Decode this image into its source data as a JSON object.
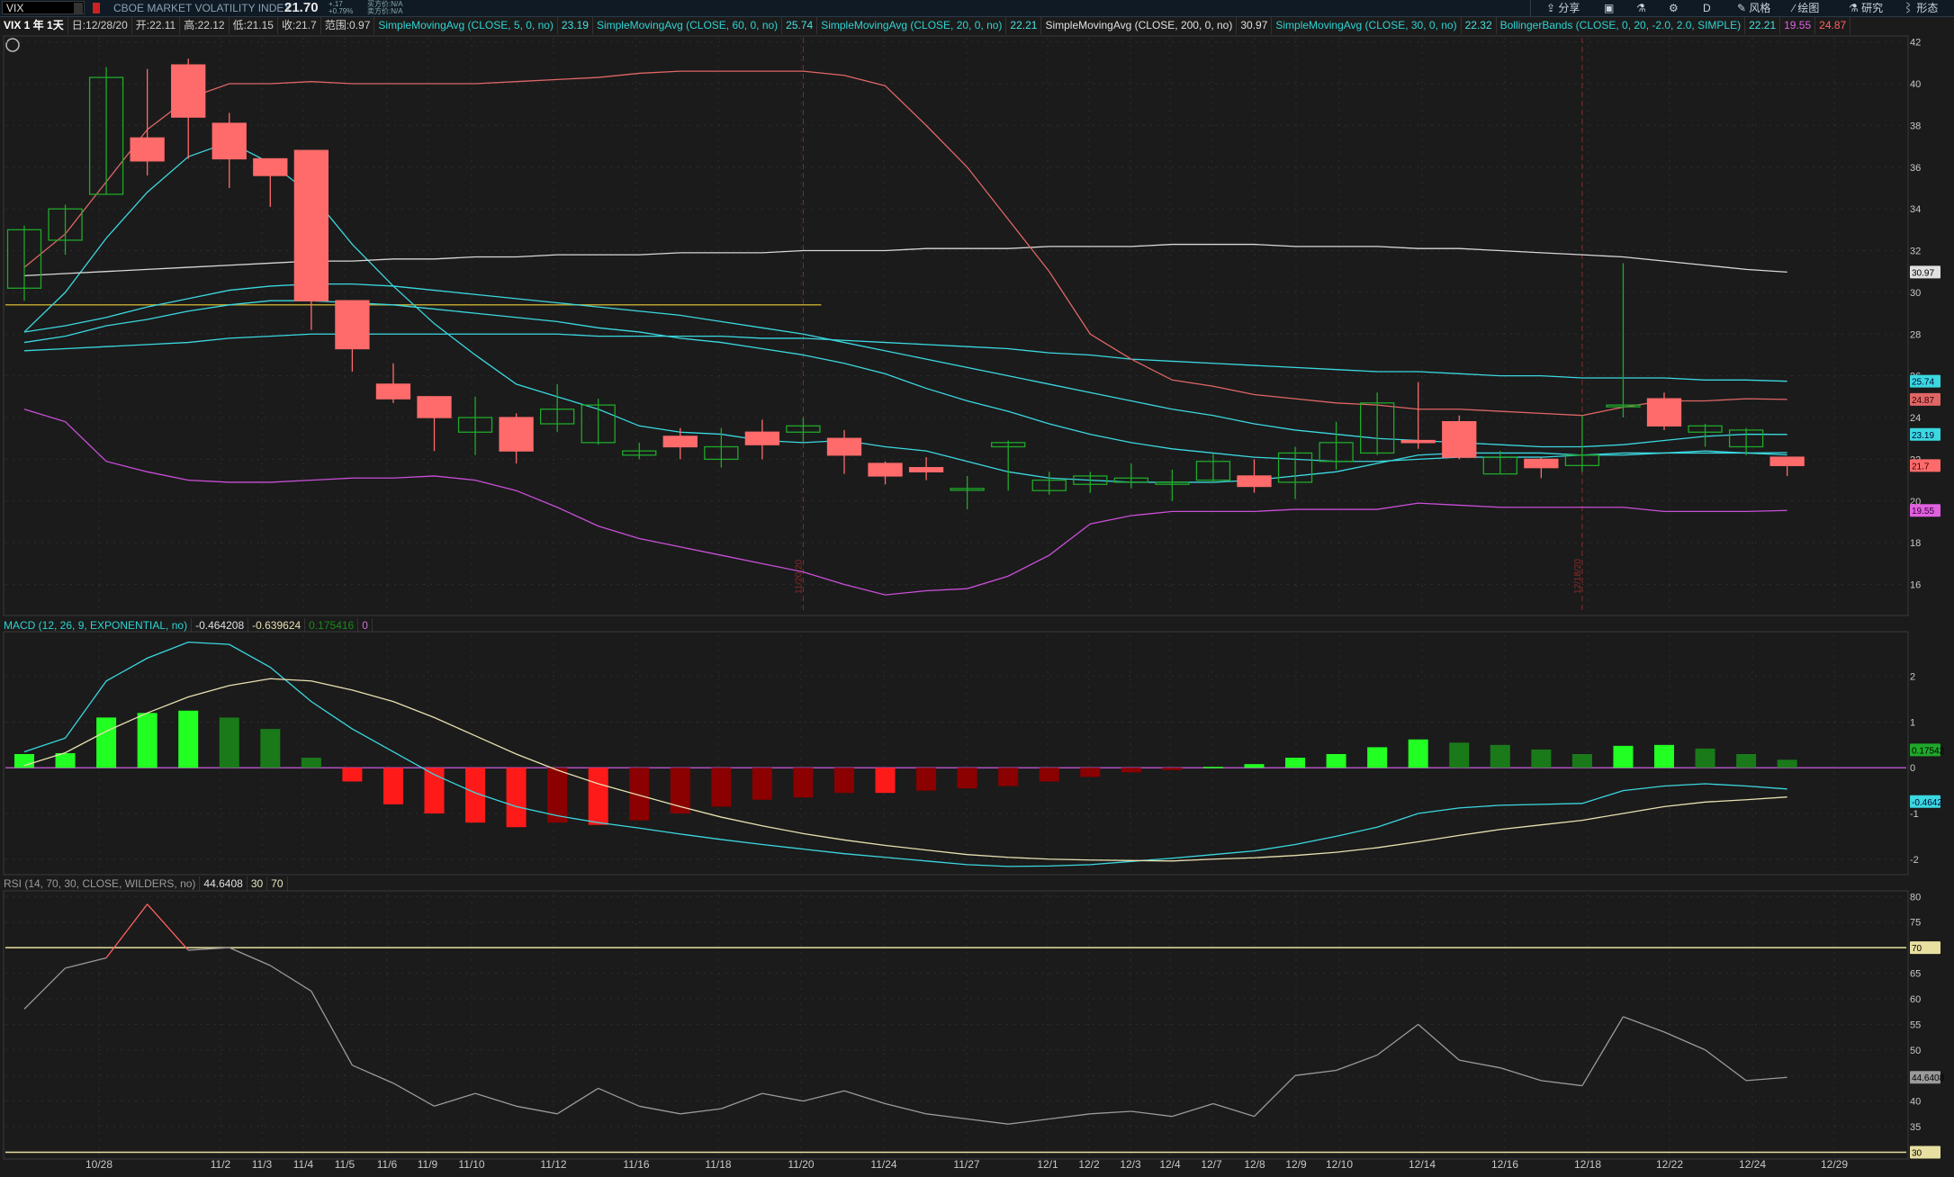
{
  "header": {
    "symbol": "VIX",
    "description": "CBOE MARKET VOLATILITY INDEX",
    "last_price": "21.70",
    "net_change": "+.17",
    "pct_change": "+0.79%",
    "bid_label": "买方价:N/A",
    "ask_label": "卖方价:N/A",
    "toolbar": {
      "share": "分享",
      "timeframe": "D",
      "style": "风格",
      "drawing": "绘图",
      "studies": "研究",
      "patterns": "形态"
    }
  },
  "infobar": {
    "chart_label": "VIX 1 年 1天",
    "date": "日:12/28/20",
    "open": "开:22.11",
    "high": "高:22.12",
    "low": "低:21.15",
    "close": "收:21.7",
    "range": "范围:0.97",
    "studies": [
      {
        "name": "SimpleMovingAvg (CLOSE, 5, 0, no)",
        "value": "23.19"
      },
      {
        "name": "SimpleMovingAvg (CLOSE, 60, 0, no)",
        "value": "25.74"
      },
      {
        "name": "SimpleMovingAvg (CLOSE, 20, 0, no)",
        "value": "22.21"
      },
      {
        "name": "SimpleMovingAvg (CLOSE, 200, 0, no)",
        "value": "30.97"
      },
      {
        "name": "SimpleMovingAvg (CLOSE, 30, 0, no)",
        "value": "22.32"
      },
      {
        "name": "BollingerBands (CLOSE, 0, 20, -2.0, 2.0, SIMPLE)",
        "value": "22.21",
        "lower": "19.55",
        "upper": "24.87"
      }
    ]
  },
  "macd_header": {
    "name": "MACD (12, 26, 9, EXPONENTIAL, no)",
    "value": "-0.464208",
    "avg": "-0.639624",
    "diff": "0.175416",
    "zero": "0"
  },
  "rsi_header": {
    "name": "RSI (14, 70, 30, CLOSE, WILDERS, no)",
    "value": "44.6408",
    "low": "30",
    "high": "70"
  },
  "markers": [
    "11/20/20",
    "12/18/20"
  ],
  "price_tags": [
    "30.97",
    "25.74",
    "24.87",
    "23.19",
    "21.7",
    "19.55"
  ],
  "macd_tags": [
    "0.17542",
    "-0.4642"
  ],
  "rsi_tags": [
    "70",
    "44.6408",
    "30"
  ],
  "colors": {
    "up": "#1fa82a",
    "down": "#ff6b6b",
    "sma5": "#3bd8e0",
    "sma20": "#3bd8e0",
    "sma30": "#3bd8e0",
    "sma60": "#3bd8e0",
    "sma200": "#d8d8d8",
    "bb_upper": "#e06666",
    "bb_lower": "#c94fd8",
    "macd": "#3bd8e0",
    "macd_avg": "#e8e0b0",
    "hist_up_bright": "#22ff22",
    "hist_up_dark": "#1a7a1a",
    "hist_down_bright": "#ff1a1a",
    "hist_down_dark": "#8b0000",
    "rsi_line": "#9a9a9a",
    "rsi_hot": "#ff6060"
  },
  "chart_data": [
    {
      "type": "candlestick",
      "title": "VIX 1 年 1天",
      "x_tick_labels": [
        "10/28",
        "11/2",
        "11/3",
        "11/4",
        "11/5",
        "11/6",
        "11/9",
        "11/10",
        "11/12",
        "11/16",
        "11/18",
        "11/20",
        "11/24",
        "11/27",
        "12/1",
        "12/2",
        "12/3",
        "12/4",
        "12/7",
        "12/8",
        "12/9",
        "12/10",
        "12/14",
        "12/16",
        "12/18",
        "12/22",
        "12/24",
        "12/29"
      ],
      "y_ticks": [
        16,
        18,
        20,
        22,
        24,
        26,
        28,
        30,
        32,
        34,
        36,
        38,
        40,
        42
      ],
      "ylim": [
        14.6,
        42.2
      ],
      "dates": [
        "10/26",
        "10/27",
        "10/28",
        "10/29",
        "10/30",
        "11/2",
        "11/3",
        "11/4",
        "11/5",
        "11/6",
        "11/9",
        "11/10",
        "11/11",
        "11/12",
        "11/13",
        "11/16",
        "11/17",
        "11/18",
        "11/19",
        "11/20",
        "11/23",
        "11/24",
        "11/25",
        "11/27",
        "11/30",
        "12/1",
        "12/2",
        "12/3",
        "12/4",
        "12/7",
        "12/8",
        "12/9",
        "12/10",
        "12/11",
        "12/14",
        "12/15",
        "12/16",
        "12/17",
        "12/18",
        "12/21",
        "12/22",
        "12/23",
        "12/24",
        "12/28"
      ],
      "open": [
        30.2,
        32.5,
        34.7,
        37.4,
        40.9,
        38.1,
        36.4,
        36.8,
        29.6,
        25.6,
        25.0,
        23.3,
        24.0,
        23.7,
        22.8,
        22.2,
        23.1,
        22.0,
        23.3,
        23.3,
        23.0,
        21.8,
        21.6,
        20.6,
        22.6,
        20.5,
        20.8,
        20.9,
        20.8,
        21.0,
        21.2,
        20.9,
        21.9,
        22.3,
        22.9,
        23.8,
        21.3,
        22.0,
        21.7,
        24.6,
        24.9,
        23.3,
        22.6,
        22.1
      ],
      "close": [
        33.0,
        34.0,
        40.3,
        36.3,
        38.4,
        36.4,
        35.6,
        29.6,
        27.3,
        24.9,
        24.0,
        24.0,
        22.4,
        24.4,
        24.6,
        22.4,
        22.6,
        22.6,
        22.7,
        23.6,
        22.2,
        21.2,
        21.4,
        20.6,
        22.8,
        21.0,
        21.2,
        21.1,
        20.9,
        21.9,
        20.7,
        22.3,
        22.8,
        24.7,
        22.8,
        22.1,
        22.1,
        21.6,
        22.2,
        24.6,
        23.6,
        23.6,
        23.4,
        21.7
      ],
      "high": [
        33.2,
        34.2,
        40.8,
        40.7,
        41.2,
        38.6,
        36.4,
        36.8,
        28.3,
        26.6,
        24.8,
        25.0,
        24.2,
        25.6,
        24.9,
        22.8,
        23.5,
        23.5,
        23.9,
        24.0,
        23.4,
        21.9,
        22.1,
        21.2,
        22.9,
        21.4,
        21.4,
        21.8,
        21.5,
        22.3,
        22.0,
        22.6,
        23.8,
        25.2,
        25.7,
        24.1,
        22.4,
        22.1,
        24.1,
        31.4,
        25.2,
        23.7,
        23.5,
        22.1
      ],
      "low": [
        29.6,
        31.8,
        34.7,
        35.6,
        36.4,
        35.0,
        34.1,
        28.2,
        26.2,
        24.7,
        22.4,
        22.2,
        21.8,
        23.3,
        22.7,
        22.0,
        22.0,
        21.6,
        22.0,
        22.8,
        21.3,
        20.8,
        21.0,
        19.6,
        20.5,
        20.3,
        20.4,
        20.6,
        20.0,
        20.9,
        20.4,
        20.1,
        21.5,
        22.2,
        22.5,
        22.0,
        21.3,
        21.1,
        21.4,
        24.0,
        23.4,
        22.6,
        22.2,
        21.2
      ],
      "series": [
        {
          "name": "SimpleMovingAvg (CLOSE, 5, 0, no)",
          "values": [
            28.1,
            30.0,
            32.6,
            34.8,
            36.5,
            37.2,
            36.2,
            34.7,
            32.3,
            30.3,
            28.5,
            27.0,
            25.6,
            25.0,
            24.4,
            23.6,
            23.3,
            23.2,
            22.9,
            22.8,
            22.9,
            22.6,
            22.4,
            21.9,
            21.4,
            21.1,
            21.0,
            20.9,
            20.9,
            20.9,
            21.0,
            21.2,
            21.4,
            21.8,
            22.2,
            22.3,
            22.3,
            22.3,
            22.2,
            22.2,
            22.3,
            22.4,
            22.3,
            22.21
          ]
        },
        {
          "name": "SimpleMovingAvg (CLOSE, 20, 0, no)",
          "values": [
            27.6,
            27.9,
            28.4,
            28.7,
            29.1,
            29.4,
            29.6,
            29.6,
            29.5,
            29.4,
            29.2,
            29.0,
            28.8,
            28.6,
            28.3,
            28.1,
            27.8,
            27.6,
            27.3,
            27.0,
            26.6,
            26.1,
            25.4,
            24.8,
            24.3,
            23.7,
            23.2,
            22.8,
            22.5,
            22.3,
            22.1,
            22.0,
            21.9,
            21.9,
            22.0,
            22.1,
            22.1,
            22.1,
            22.2,
            22.3,
            22.3,
            22.3,
            22.3,
            22.32
          ]
        },
        {
          "name": "SimpleMovingAvg (CLOSE, 30, 0, no)",
          "values": [
            28.1,
            28.4,
            28.8,
            29.3,
            29.7,
            30.1,
            30.3,
            30.4,
            30.4,
            30.3,
            30.1,
            29.9,
            29.7,
            29.5,
            29.3,
            29.1,
            28.9,
            28.6,
            28.3,
            28.0,
            27.6,
            27.2,
            26.8,
            26.4,
            26.0,
            25.6,
            25.2,
            24.8,
            24.4,
            24.1,
            23.7,
            23.4,
            23.2,
            23.0,
            22.9,
            22.8,
            22.7,
            22.6,
            22.6,
            22.7,
            22.9,
            23.1,
            23.2,
            23.19
          ]
        },
        {
          "name": "SimpleMovingAvg (CLOSE, 60, 0, no)",
          "values": [
            27.2,
            27.3,
            27.4,
            27.5,
            27.6,
            27.8,
            27.9,
            28.0,
            28.0,
            28.0,
            28.0,
            28.0,
            28.0,
            28.0,
            27.9,
            27.9,
            27.9,
            27.9,
            27.8,
            27.8,
            27.7,
            27.6,
            27.5,
            27.4,
            27.3,
            27.1,
            27.0,
            26.8,
            26.7,
            26.6,
            26.5,
            26.4,
            26.3,
            26.2,
            26.2,
            26.1,
            26.0,
            26.0,
            25.9,
            25.9,
            25.9,
            25.8,
            25.8,
            25.74
          ]
        },
        {
          "name": "SimpleMovingAvg (CLOSE, 200, 0, no)",
          "values": [
            30.8,
            30.9,
            31.0,
            31.1,
            31.2,
            31.3,
            31.4,
            31.5,
            31.5,
            31.6,
            31.6,
            31.7,
            31.7,
            31.8,
            31.8,
            31.8,
            31.9,
            31.9,
            31.9,
            32.0,
            32.0,
            32.0,
            32.1,
            32.1,
            32.1,
            32.2,
            32.2,
            32.2,
            32.3,
            32.3,
            32.3,
            32.2,
            32.2,
            32.2,
            32.1,
            32.1,
            32.0,
            31.9,
            31.8,
            31.7,
            31.5,
            31.3,
            31.1,
            30.97
          ]
        },
        {
          "name": "BollingerBands upper",
          "values": [
            31.2,
            32.8,
            35.3,
            37.8,
            39.3,
            40.0,
            40.0,
            40.1,
            40.0,
            40.0,
            40.0,
            40.0,
            40.1,
            40.2,
            40.3,
            40.5,
            40.6,
            40.6,
            40.6,
            40.6,
            40.4,
            39.9,
            38.0,
            36.0,
            33.5,
            31.0,
            28.0,
            26.8,
            25.8,
            25.5,
            25.1,
            24.9,
            24.7,
            24.6,
            24.4,
            24.4,
            24.3,
            24.2,
            24.1,
            24.5,
            24.8,
            24.8,
            24.9,
            24.87
          ]
        },
        {
          "name": "BollingerBands lower",
          "values": [
            24.4,
            23.8,
            21.9,
            21.4,
            21.0,
            20.9,
            20.9,
            21.0,
            21.1,
            21.1,
            21.2,
            21.0,
            20.5,
            19.7,
            18.8,
            18.2,
            17.8,
            17.4,
            17.0,
            16.6,
            16.0,
            15.5,
            15.7,
            15.8,
            16.4,
            17.4,
            18.9,
            19.3,
            19.5,
            19.5,
            19.5,
            19.6,
            19.6,
            19.6,
            19.9,
            19.8,
            19.7,
            19.7,
            19.7,
            19.7,
            19.5,
            19.5,
            19.5,
            19.55
          ]
        }
      ],
      "horizontal_line": {
        "value": 29.4,
        "from": "10/26",
        "to": "11/20"
      }
    },
    {
      "type": "line+bar",
      "title": "MACD (12, 26, 9, EXPONENTIAL, no)",
      "y_ticks": [
        -2,
        -1,
        0,
        1,
        2
      ],
      "ylim": [
        -2.3,
        2.9
      ],
      "dates": [
        "10/26",
        "10/27",
        "10/28",
        "10/29",
        "10/30",
        "11/2",
        "11/3",
        "11/4",
        "11/5",
        "11/6",
        "11/9",
        "11/10",
        "11/11",
        "11/12",
        "11/13",
        "11/16",
        "11/17",
        "11/18",
        "11/19",
        "11/20",
        "11/23",
        "11/24",
        "11/25",
        "11/27",
        "11/30",
        "12/1",
        "12/2",
        "12/3",
        "12/4",
        "12/7",
        "12/8",
        "12/9",
        "12/10",
        "12/11",
        "12/14",
        "12/15",
        "12/16",
        "12/17",
        "12/18",
        "12/21",
        "12/22",
        "12/23",
        "12/24",
        "12/28"
      ],
      "series": [
        {
          "name": "Value",
          "values": [
            0.35,
            0.65,
            1.9,
            2.4,
            2.75,
            2.7,
            2.2,
            1.45,
            0.85,
            0.35,
            -0.15,
            -0.55,
            -0.85,
            -1.05,
            -1.2,
            -1.32,
            -1.45,
            -1.57,
            -1.68,
            -1.78,
            -1.88,
            -1.96,
            -2.04,
            -2.12,
            -2.16,
            -2.15,
            -2.12,
            -2.05,
            -1.98,
            -1.9,
            -1.82,
            -1.68,
            -1.5,
            -1.3,
            -1.0,
            -0.88,
            -0.82,
            -0.8,
            -0.78,
            -0.5,
            -0.4,
            -0.35,
            -0.4,
            -0.4642
          ]
        },
        {
          "name": "Avg",
          "values": [
            0.05,
            0.33,
            0.8,
            1.2,
            1.55,
            1.8,
            1.95,
            1.9,
            1.7,
            1.45,
            1.1,
            0.7,
            0.3,
            -0.05,
            -0.35,
            -0.6,
            -0.85,
            -1.08,
            -1.27,
            -1.44,
            -1.58,
            -1.7,
            -1.8,
            -1.9,
            -1.96,
            -2.0,
            -2.02,
            -2.03,
            -2.04,
            -2.0,
            -1.97,
            -1.92,
            -1.85,
            -1.75,
            -1.62,
            -1.48,
            -1.35,
            -1.25,
            -1.15,
            -1.0,
            -0.85,
            -0.75,
            -0.7,
            -0.6396
          ]
        },
        {
          "name": "Diff",
          "values": [
            0.3,
            0.32,
            1.1,
            1.2,
            1.25,
            1.1,
            0.85,
            0.22,
            -0.3,
            -0.8,
            -1.0,
            -1.2,
            -1.3,
            -1.2,
            -1.25,
            -1.15,
            -1.0,
            -0.85,
            -0.7,
            -0.65,
            -0.55,
            -0.55,
            -0.5,
            -0.45,
            -0.4,
            -0.3,
            -0.2,
            -0.1,
            -0.05,
            0.02,
            0.08,
            0.22,
            0.3,
            0.45,
            0.62,
            0.55,
            0.5,
            0.4,
            0.3,
            0.48,
            0.5,
            0.42,
            0.3,
            0.1754
          ]
        }
      ]
    },
    {
      "type": "line",
      "title": "RSI (14, 70, 30, CLOSE, WILDERS, no)",
      "y_ticks": [
        30,
        35,
        40,
        45,
        50,
        55,
        60,
        65,
        70,
        75,
        80
      ],
      "ylim": [
        29.2,
        80.4
      ],
      "dates": [
        "10/26",
        "10/27",
        "10/28",
        "10/29",
        "10/30",
        "11/2",
        "11/3",
        "11/4",
        "11/5",
        "11/6",
        "11/9",
        "11/10",
        "11/11",
        "11/12",
        "11/13",
        "11/16",
        "11/17",
        "11/18",
        "11/19",
        "11/20",
        "11/23",
        "11/24",
        "11/25",
        "11/27",
        "11/30",
        "12/1",
        "12/2",
        "12/3",
        "12/4",
        "12/7",
        "12/8",
        "12/9",
        "12/10",
        "12/11",
        "12/14",
        "12/15",
        "12/16",
        "12/17",
        "12/18",
        "12/21",
        "12/22",
        "12/23",
        "12/24",
        "12/28"
      ],
      "series": [
        {
          "name": "RSI",
          "values": [
            58.0,
            66.0,
            68.0,
            78.5,
            69.5,
            70.0,
            66.5,
            61.5,
            47.0,
            43.5,
            39.0,
            41.5,
            39.0,
            37.5,
            42.5,
            39.0,
            37.5,
            38.5,
            41.5,
            40.0,
            42.0,
            39.5,
            37.5,
            36.5,
            35.5,
            36.5,
            37.5,
            38.0,
            37.0,
            39.5,
            37.0,
            45.0,
            46.0,
            49.0,
            55.0,
            48.0,
            46.5,
            44.0,
            43.0,
            56.5,
            53.5,
            50.0,
            44.0,
            44.6408
          ]
        }
      ],
      "levels": [
        {
          "name": "OverBought",
          "value": 70
        },
        {
          "name": "OverSold",
          "value": 30
        }
      ]
    }
  ]
}
